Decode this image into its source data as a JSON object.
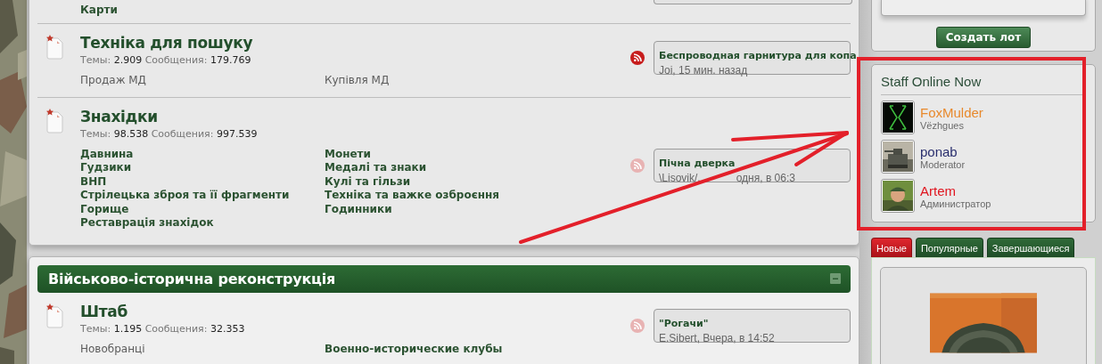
{
  "top_panel": {
    "partial_row": {
      "subforums": [
        {
          "label": "Карти",
          "unread": true
        }
      ]
    },
    "forums": [
      {
        "title": "Техніка для пошуку",
        "stats": [
          {
            "label": "Темы:",
            "value": "2.909"
          },
          {
            "label": "Сообщения:",
            "value": "179.769"
          }
        ],
        "feed_active": true,
        "last_post": {
          "title": "Беспроводная гарнитура для копа",
          "meta_parts": [
            "Joi, 15 мин. назад"
          ]
        },
        "subforums": [
          {
            "label": "Продаж МД",
            "unread": false
          },
          {
            "label": "Купівля МД",
            "unread": false
          }
        ]
      },
      {
        "title": "Знахідки",
        "stats": [
          {
            "label": "Темы:",
            "value": "98.538"
          },
          {
            "label": "Сообщения:",
            "value": "997.539"
          }
        ],
        "feed_active": false,
        "last_post": {
          "title": "Пічна дверка",
          "meta_parts": [
            "\\Lisovik/,",
            "одня, в 06:3"
          ]
        },
        "subforums": [
          {
            "label": "Давнина",
            "unread": true
          },
          {
            "label": "Гудзики",
            "unread": true
          },
          {
            "label": "ВНП",
            "unread": true
          },
          {
            "label": "Стрілецька зброя та її фрагменти",
            "unread": true
          },
          {
            "label": "Горище",
            "unread": true
          },
          {
            "label": "Реставрація знахідок",
            "unread": true
          },
          {
            "label": "Монети",
            "unread": true
          },
          {
            "label": "Медалі та знаки",
            "unread": true
          },
          {
            "label": "Кулі та гільзи",
            "unread": true
          },
          {
            "label": "Техніка та важке озброєння",
            "unread": true
          },
          {
            "label": "Годинники",
            "unread": true
          }
        ]
      }
    ]
  },
  "reconstruction_panel": {
    "title": "Військово-історична реконструкція",
    "forums": [
      {
        "title": "Штаб",
        "stats": [
          {
            "label": "Темы:",
            "value": "1.195"
          },
          {
            "label": "Сообщения:",
            "value": "32.353"
          }
        ],
        "feed_active": false,
        "last_post": {
          "title": "\"Рогачи\"",
          "meta_parts": [
            "E.Sibert, Вчера, в 14:52"
          ]
        },
        "subforums": [
          {
            "label": "Новобранці",
            "unread": false
          },
          {
            "label": "Военно-исторические клубы",
            "unread": true
          }
        ]
      }
    ]
  },
  "sidebar": {
    "create_button": "Создать лот",
    "staff": {
      "title": "Staff Online Now",
      "members": [
        {
          "name": "FoxMulder",
          "role": "Vëzhgues",
          "color": "#e8892c"
        },
        {
          "name": "ponab",
          "role": "Moderator",
          "color": "#2a2f6e"
        },
        {
          "name": "Artem",
          "role": "Администратор",
          "color": "#e0141e"
        }
      ]
    },
    "tabs": [
      {
        "label": "Новые",
        "selected": true
      },
      {
        "label": "Популярные",
        "selected": false
      },
      {
        "label": "Завершающиеся",
        "selected": false
      }
    ]
  }
}
